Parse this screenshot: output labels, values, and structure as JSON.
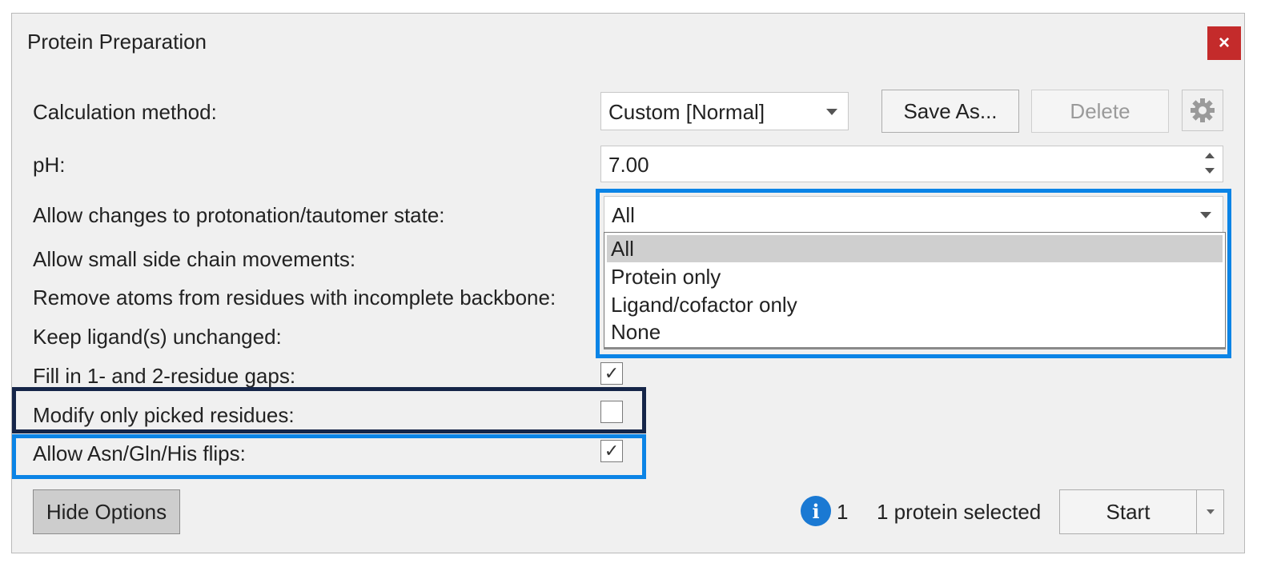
{
  "window": {
    "title": "Protein Preparation",
    "close_label": "×"
  },
  "calc_method": {
    "label": "Calculation method:",
    "value": "Custom [Normal]"
  },
  "buttons": {
    "save_as": "Save As...",
    "delete": "Delete",
    "hide_options": "Hide Options",
    "start": "Start"
  },
  "ph": {
    "label": "pH:",
    "value": "7.00"
  },
  "protonation": {
    "label": "Allow changes to protonation/tautomer state:",
    "value": "All",
    "options": [
      "All",
      "Protein only",
      "Ligand/cofactor only",
      "None"
    ]
  },
  "options": {
    "side_chain": "Allow small side chain movements:",
    "remove_atoms": "Remove atoms from residues with incomplete backbone:",
    "keep_ligands": "Keep ligand(s) unchanged:",
    "fill_gaps": {
      "label": "Fill in 1- and 2-residue gaps:",
      "checked": true
    },
    "modify_picked": {
      "label": "Modify only picked residues:",
      "checked": false
    },
    "flips": {
      "label": "Allow Asn/Gln/His flips:",
      "checked": true
    }
  },
  "footer": {
    "info_count": "1",
    "status": "1 protein selected"
  },
  "colors": {
    "highlight_blue": "#0b84e6",
    "highlight_navy": "#152548",
    "close_red": "#c42b2b",
    "info_blue": "#1a79d3"
  },
  "icons": [
    "close-icon",
    "chevron-down-icon",
    "gear-icon",
    "spin-up-icon",
    "spin-down-icon",
    "checkmark-icon",
    "info-icon"
  ]
}
